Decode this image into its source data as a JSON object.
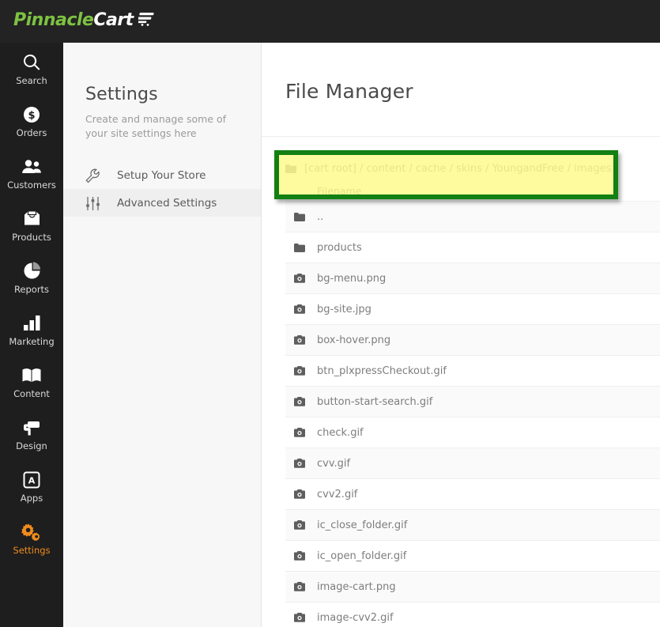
{
  "brand": {
    "name_part1": "Pinnacle",
    "name_part2": "Cart",
    "cart_icon": "shopping-cart-icon",
    "green": "#7DC242",
    "accent_orange": "#F08C1E"
  },
  "rail": {
    "items": [
      {
        "label": "Search",
        "icon": "search-icon",
        "active": false
      },
      {
        "label": "Orders",
        "icon": "dollar-circle-icon",
        "active": false
      },
      {
        "label": "Customers",
        "icon": "customers-icon",
        "active": false
      },
      {
        "label": "Products",
        "icon": "shopping-bag-icon",
        "active": false
      },
      {
        "label": "Reports",
        "icon": "pie-chart-icon",
        "active": false
      },
      {
        "label": "Marketing",
        "icon": "bar-chart-icon",
        "active": false
      },
      {
        "label": "Content",
        "icon": "book-icon",
        "active": false
      },
      {
        "label": "Design",
        "icon": "paint-roller-icon",
        "active": false
      },
      {
        "label": "Apps",
        "icon": "apps-icon",
        "active": false
      },
      {
        "label": "Settings",
        "icon": "gears-icon",
        "active": true
      }
    ]
  },
  "settings_panel": {
    "title": "Settings",
    "description": "Create and manage some of your site settings here",
    "menu": [
      {
        "label": "Setup Your Store",
        "icon": "wrench-icon",
        "active": false
      },
      {
        "label": "Advanced Settings",
        "icon": "sliders-icon",
        "active": true
      }
    ]
  },
  "main": {
    "page_title": "File Manager",
    "breadcrumb": {
      "folder_icon": "folder-icon",
      "path": "[cart root] / content / cache / skins / YoungandFree / images /",
      "highlight": {
        "border_color": "#128012",
        "fill_color": "#FDFA82"
      }
    },
    "table": {
      "column_header": "Filename",
      "rows": [
        {
          "name": "..",
          "icon": "folder-icon"
        },
        {
          "name": "products",
          "icon": "folder-icon"
        },
        {
          "name": "bg-menu.png",
          "icon": "camera-icon"
        },
        {
          "name": "bg-site.jpg",
          "icon": "camera-icon"
        },
        {
          "name": "box-hover.png",
          "icon": "camera-icon"
        },
        {
          "name": "btn_plxpressCheckout.gif",
          "icon": "camera-icon"
        },
        {
          "name": "button-start-search.gif",
          "icon": "camera-icon"
        },
        {
          "name": "check.gif",
          "icon": "camera-icon"
        },
        {
          "name": "cvv.gif",
          "icon": "camera-icon"
        },
        {
          "name": "cvv2.gif",
          "icon": "camera-icon"
        },
        {
          "name": "ic_close_folder.gif",
          "icon": "camera-icon"
        },
        {
          "name": "ic_open_folder.gif",
          "icon": "camera-icon"
        },
        {
          "name": "image-cart.png",
          "icon": "camera-icon"
        },
        {
          "name": "image-cvv2.gif",
          "icon": "camera-icon"
        }
      ]
    }
  }
}
